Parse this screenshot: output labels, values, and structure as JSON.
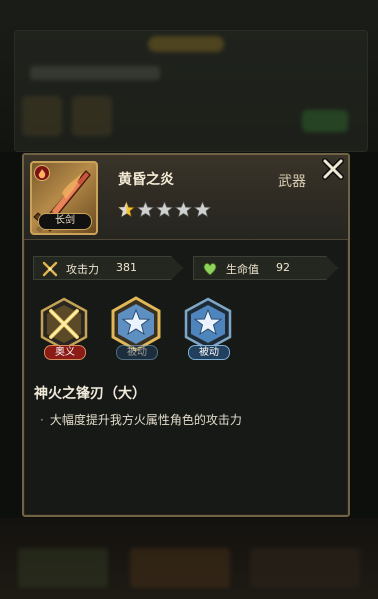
{
  "item": {
    "name": "黄昏之炎",
    "category": "武器",
    "type_tag": "长剑",
    "stars_total": 5,
    "stars_filled": 1
  },
  "stats": [
    {
      "label": "攻击力",
      "value": "381",
      "icon": "swords-icon"
    },
    {
      "label": "生命值",
      "value": "92",
      "icon": "heart-icon"
    }
  ],
  "skills": [
    {
      "tag": "奥义",
      "icon": "crossed-swords-skill-icon"
    },
    {
      "tag": "被动",
      "icon": "star-hexagon-skill-icon"
    },
    {
      "tag": "被动",
      "icon": "star-hexagon-skill-icon"
    }
  ],
  "skill_detail": {
    "name": "神火之锋刃（大）",
    "description": "大幅度提升我方火属性角色的攻击力"
  },
  "colors": {
    "border_gold": "#6f6245",
    "passive_blue": "#22405e",
    "ultimate_red": "#8a1b17"
  }
}
